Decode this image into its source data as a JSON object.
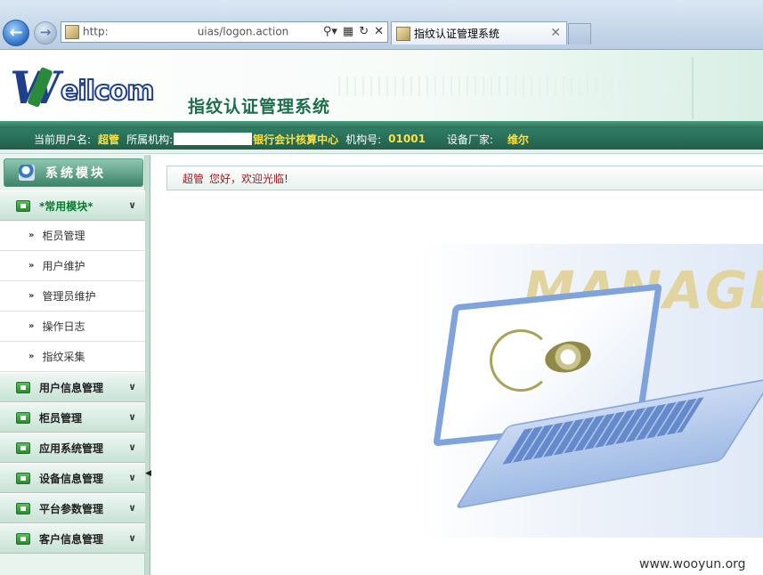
{
  "browser": {
    "address_prefix": "http:",
    "address_suffix": "uias/logon.action",
    "tab_title": "指纹认证管理系统",
    "icons": [
      "back-arrow-icon",
      "forward-arrow-icon",
      "page-icon",
      "search-icon",
      "refresh-icon",
      "close-icon"
    ]
  },
  "header": {
    "logo_w": "W",
    "logo_rest": "eilcom",
    "title": "指纹认证管理系统"
  },
  "infobar": {
    "user_label": "当前用户名:",
    "user_value": "超管",
    "org_label": "所属机构:",
    "org_value": "银行会计核算中心",
    "org_no_label": "机构号:",
    "org_no_value": "01001",
    "vendor_label": "设备厂家:",
    "vendor_value": "维尔"
  },
  "sidebar": {
    "title": "系统模块",
    "common_group": "*常用模块*",
    "common_items": [
      "柜员管理",
      "用户维护",
      "管理员维护",
      "操作日志",
      "指纹采集"
    ],
    "groups": [
      "用户信息管理",
      "柜员管理",
      "应用系统管理",
      "设备信息管理",
      "平台参数管理",
      "客户信息管理"
    ]
  },
  "main": {
    "welcome_user": "超管",
    "welcome_text": "您好，欢迎光临!",
    "hero_word": "MANAGEME"
  },
  "watermark": "www.wooyun.org",
  "colors": {
    "infobar_bg": "#2f7c64",
    "highlight_text": "#ffe13a",
    "title_green": "#1d6d4b",
    "welcome_red": "#a01a1a"
  }
}
